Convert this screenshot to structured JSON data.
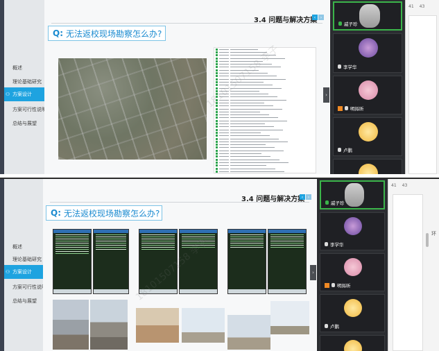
{
  "slide": {
    "title": "3.4 问题与解决方案",
    "question": "无法返校现场勘察怎么办?",
    "question_prefix": "Q:",
    "nav": [
      {
        "label": "概述",
        "active": false
      },
      {
        "label": "理论基础研究",
        "active": false
      },
      {
        "label": "方案设计",
        "active": true
      },
      {
        "label": "方案可行性说明",
        "active": false
      },
      {
        "label": "总结与展望",
        "active": false
      }
    ],
    "watermark": "18101507158 李子"
  },
  "participants": [
    {
      "name": "戚子珍",
      "mic": "on",
      "host": false
    },
    {
      "name": "李学华",
      "mic": "off",
      "host": false
    },
    {
      "name": "明拟昕",
      "mic": "off",
      "host": true
    },
    {
      "name": "卢鹏",
      "mic": "off",
      "host": false
    }
  ],
  "doc": {
    "ruler": [
      "41",
      "43"
    ],
    "side_char": "环"
  },
  "colors": {
    "accent": "#1ea3e0",
    "speaking": "#3bb54a"
  }
}
